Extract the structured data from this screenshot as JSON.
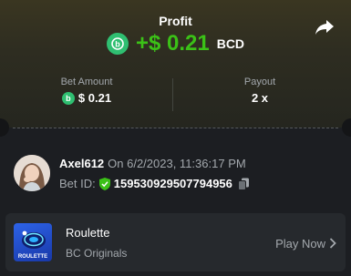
{
  "profit": {
    "label": "Profit",
    "amount": "+$ 0.21",
    "currency": "BCD",
    "coin_icon": "bcd-coin-icon"
  },
  "bet": {
    "amount_label": "Bet Amount",
    "amount_value": "$ 0.21",
    "payout_label": "Payout",
    "payout_value": "2 x"
  },
  "user": {
    "name": "Axel612",
    "date": "On 6/2/2023, 11:36:17 PM",
    "bet_id_label": "Bet ID:",
    "bet_id": "159530929507794956"
  },
  "game": {
    "name": "Roulette",
    "provider": "BC Originals",
    "action": "Play Now",
    "thumb_label": "ROULETTE"
  },
  "colors": {
    "profit": "#3bc117",
    "coin": "#2fbf71",
    "shield": "#3bc117"
  }
}
